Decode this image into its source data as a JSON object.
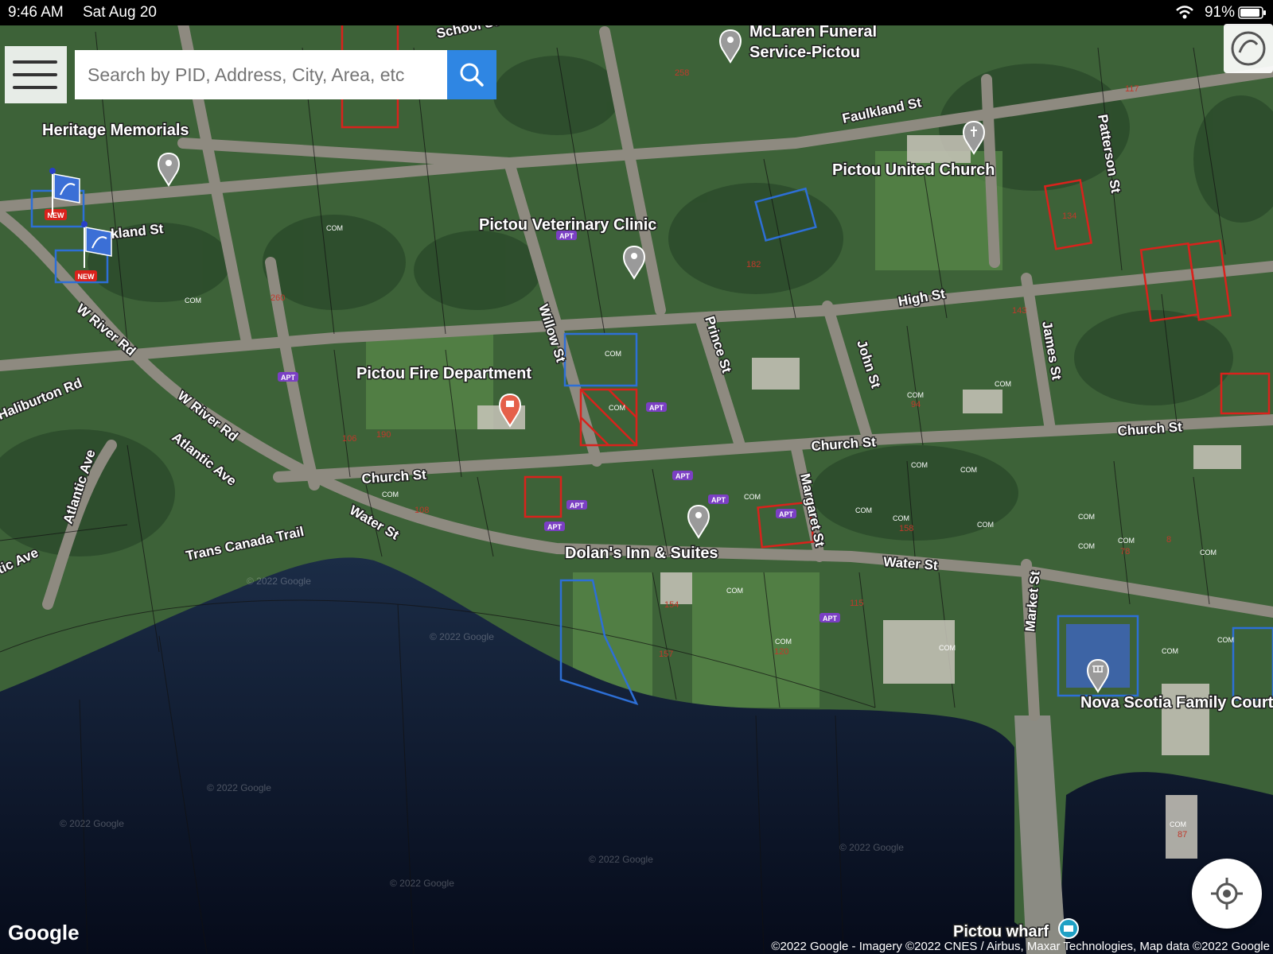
{
  "status_bar": {
    "time": "9:46 AM",
    "date": "Sat Aug 20",
    "battery": "91%"
  },
  "search": {
    "placeholder": "Search by PID, Address, City, Area, etc"
  },
  "icons": {
    "menu": "menu-icon",
    "search": "search-icon",
    "locate": "my-location-icon",
    "crea": "crea-logo-icon"
  },
  "branding": {
    "google": "Google",
    "attribution": "©2022 Google - Imagery ©2022 CNES / Airbus, Maxar Technologies, Map data ©2022 Google",
    "watermark": "© 2022 Google"
  },
  "places": [
    {
      "name": "McLaren Funeral\nService-Pictou",
      "icon": "pin-grey",
      "line1": "McLaren Funeral",
      "line2": "Service-Pictou"
    },
    {
      "name": "Heritage Memorials",
      "icon": "pin-grey"
    },
    {
      "name": "Pictou United Church",
      "icon": "pin-church"
    },
    {
      "name": "Pictou Veterinary Clinic",
      "icon": "pin-grey"
    },
    {
      "name": "Pictou Fire Department",
      "icon": "pin-red"
    },
    {
      "name": "Dolan's Inn & Suites",
      "icon": "pin-grey"
    },
    {
      "name": "Nova Scotia Family Court",
      "icon": "pin-court"
    },
    {
      "name": "Pictou wharf",
      "icon": "pin-camera"
    }
  ],
  "streets": [
    "School St",
    "Faulkland St",
    "kland St",
    "Patterson St",
    "High St",
    "Willow St",
    "Prince St",
    "John St",
    "James St",
    "W River Rd",
    "Haliburton Rd",
    "Atlantic Ave",
    "Church St",
    "Water St",
    "Margaret St",
    "Trans Canada Trail",
    "Market St",
    "tic Ave"
  ],
  "badges": {
    "new": "NEW",
    "apt": "APT",
    "com": "COM"
  },
  "lot_numbers": [
    "258",
    "182",
    "134",
    "143",
    "94",
    "115",
    "120",
    "157",
    "154",
    "158",
    "108",
    "106",
    "190",
    "260",
    "8",
    "78",
    "87",
    "117"
  ],
  "colors": {
    "search_button": "#2f86e3",
    "listing_blue": "#2d6fd6",
    "listing_red": "#d9221c",
    "apt_badge": "#7b3fc4",
    "new_badge": "#d9221c",
    "water": "#0d1a33"
  }
}
